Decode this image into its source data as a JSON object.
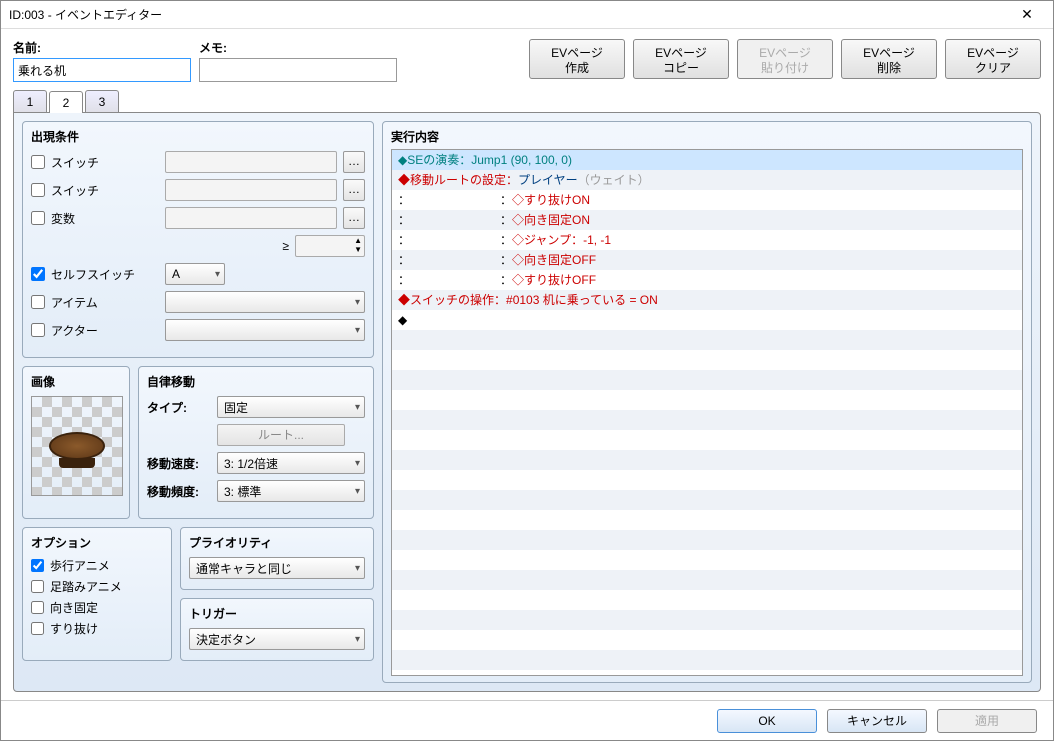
{
  "window": {
    "title": "ID:003 - イベントエディター"
  },
  "header": {
    "name_label": "名前:",
    "name_value": "乗れる机",
    "memo_label": "メモ:",
    "memo_value": "",
    "buttons": {
      "new": "EVページ\n作成",
      "copy": "EVページ\nコピー",
      "paste": "EVページ\n貼り付け",
      "delete": "EVページ\n削除",
      "clear": "EVページ\nクリア"
    }
  },
  "tabs": [
    "1",
    "2",
    "3"
  ],
  "active_tab": 1,
  "conditions": {
    "title": "出現条件",
    "switch1_label": "スイッチ",
    "switch2_label": "スイッチ",
    "variable_label": "変数",
    "gte_label": "≥",
    "selfswitch_label": "セルフスイッチ",
    "selfswitch_value": "A",
    "selfswitch_checked": true,
    "item_label": "アイテム",
    "actor_label": "アクター"
  },
  "image": {
    "title": "画像"
  },
  "automove": {
    "title": "自律移動",
    "type_label": "タイプ:",
    "type_value": "固定",
    "route_label": "ルート...",
    "speed_label": "移動速度:",
    "speed_value": "3: 1/2倍速",
    "freq_label": "移動頻度:",
    "freq_value": "3: 標準"
  },
  "options": {
    "title": "オプション",
    "walk_anim": "歩行アニメ",
    "walk_anim_checked": true,
    "step_anim": "足踏みアニメ",
    "dir_fix": "向き固定",
    "through": "すり抜け"
  },
  "priority": {
    "title": "プライオリティ",
    "value": "通常キャラと同じ"
  },
  "trigger": {
    "title": "トリガー",
    "value": "決定ボタン"
  },
  "commands_title": "実行内容",
  "commands": [
    {
      "prefix": "◆",
      "prefixColor": "c-teal",
      "text": "SEの演奏：Jump1 (90, 100, 0)",
      "textColor": "c-teal",
      "selected": true
    },
    {
      "prefix": "◆",
      "prefixColor": "c-redtext",
      "t1": "移動ルートの設定：",
      "c1": "c-redtext",
      "t2": "プレイヤー",
      "c2": "c-blue",
      "t3": "（ウェイト）",
      "c3": "c-gray"
    },
    {
      "prefix": "：",
      "prefixColor": "",
      "pad": "　　　　　　　　：",
      "text": "◇すり抜けON",
      "textColor": "c-redtext"
    },
    {
      "prefix": "：",
      "prefixColor": "",
      "pad": "　　　　　　　　：",
      "text": "◇向き固定ON",
      "textColor": "c-redtext"
    },
    {
      "prefix": "：",
      "prefixColor": "",
      "pad": "　　　　　　　　：",
      "text": "◇ジャンプ：-1, -1",
      "textColor": "c-redtext"
    },
    {
      "prefix": "：",
      "prefixColor": "",
      "pad": "　　　　　　　　：",
      "text": "◇向き固定OFF",
      "textColor": "c-redtext"
    },
    {
      "prefix": "：",
      "prefixColor": "",
      "pad": "　　　　　　　　：",
      "text": "◇すり抜けOFF",
      "textColor": "c-redtext"
    },
    {
      "prefix": "◆",
      "prefixColor": "c-redtext",
      "t1": "スイッチの操作：",
      "c1": "c-redtext",
      "t2": "#0103 机に乗っている = ON",
      "c2": "c-red"
    },
    {
      "prefix": "◆",
      "prefixColor": ""
    }
  ],
  "footer": {
    "ok": "OK",
    "cancel": "キャンセル",
    "apply": "適用"
  }
}
